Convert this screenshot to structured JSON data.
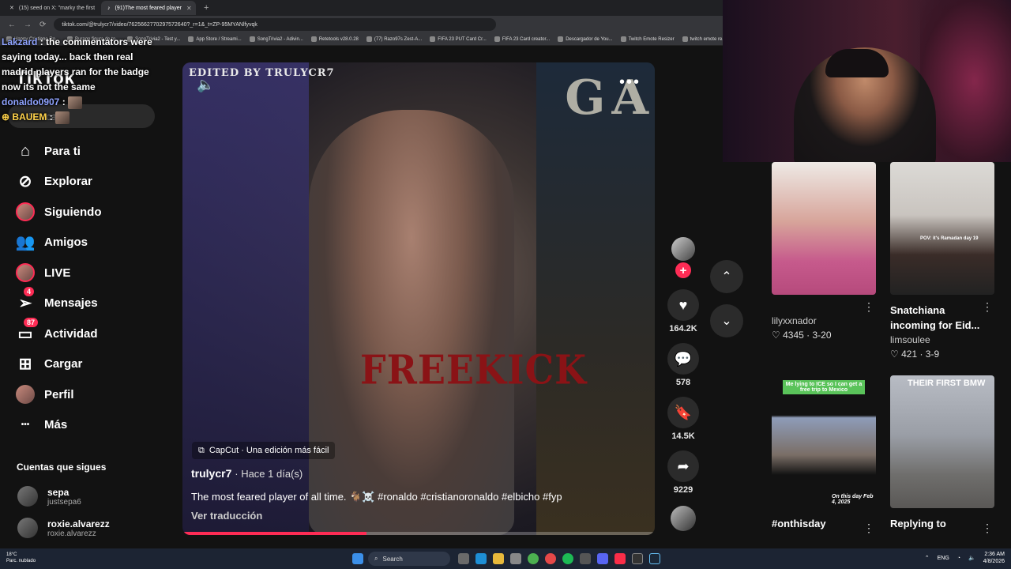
{
  "browser": {
    "tabs": [
      {
        "label": "(15) seed on X: \"marky the first",
        "active": false
      },
      {
        "label": "(91)The most feared player",
        "active": true
      }
    ],
    "url": "tiktok.com/@trulycr7/video/7625662770297572640?_r=1&_t=ZP-95MYANlfyvqk",
    "bookmarks": [
      "Happy Cristiano Ro...",
      "Burago figura de to...",
      "SongTrivia2 - Test y...",
      "App Store / Streami...",
      "SongTrivia2 - Adivin...",
      "Retetools v28.0.28",
      "(77) Razo97s Zest-A...",
      "FIFA 23 PUT Card Cr...",
      "FIFA 23 Card creator...",
      "Descargador de You...",
      "Twitch Emote Resizer",
      "twitch emote re..."
    ]
  },
  "sidebar": {
    "logo": "TikTok",
    "search_placeholder": "Buscar",
    "nav": [
      {
        "label": "Para ti",
        "icon": "home-icon"
      },
      {
        "label": "Explorar",
        "icon": "compass-icon"
      },
      {
        "label": "Siguiendo",
        "icon": "following-avatar-icon"
      },
      {
        "label": "Amigos",
        "icon": "friends-icon"
      },
      {
        "label": "LIVE",
        "icon": "live-avatar-icon"
      },
      {
        "label": "Mensajes",
        "icon": "messages-icon",
        "badge": "4"
      },
      {
        "label": "Actividad",
        "icon": "activity-icon",
        "badge": "87"
      },
      {
        "label": "Cargar",
        "icon": "upload-icon"
      },
      {
        "label": "Perfil",
        "icon": "profile-icon"
      },
      {
        "label": "Más",
        "icon": "more-icon"
      }
    ],
    "following_title": "Cuentas que sigues",
    "following": [
      {
        "name": "sepa",
        "handle": "justsepa6"
      },
      {
        "name": "roxie.alvarezz",
        "handle": "roxie.alvarezz"
      }
    ]
  },
  "chat": {
    "lines": [
      {
        "user": "Lakzard",
        "text": "the commentators were saying today... back then real madrid players ran for the badge now its not the same"
      },
      {
        "user": "donaldo0907",
        "text": ""
      },
      {
        "user": "BAUEM",
        "text": ""
      }
    ]
  },
  "video": {
    "watermark": "EDITED BY TRULYCR7",
    "overlay_text": "FREEKICK",
    "capcut": "CapCut · Una edición más fácil",
    "author": "trulycr7",
    "posted": "· Hace 1 día(s)",
    "caption": "The most feared player of all time. 🐐☠️ #ronaldo #cristianoronaldo #elbicho #fyp",
    "translate": "Ver traducción",
    "progress_percent": 39
  },
  "actions": {
    "likes": "164.2K",
    "comments": "578",
    "saves": "14.5K",
    "shares": "9229"
  },
  "feed": [
    {
      "title": "",
      "author": "lilyxxnador",
      "likes": "4345",
      "date": "3-20",
      "thumb_color": "#c9847e"
    },
    {
      "title": "Snatchiana incoming for Eid...",
      "author": "limsoulee",
      "likes": "421",
      "date": "3-9",
      "thumb_color": "#d8d6d2",
      "thumb_text": "POV: it's Ramadan day 19"
    },
    {
      "title": "#onthisday",
      "author": "",
      "likes": "",
      "date": "",
      "thumb_color": "#f2f2f2",
      "thumb_text": "Me lying to ICE so I can get a free trip to Mexico",
      "thumb_text2": "On this day Feb 4, 2025"
    },
    {
      "title": "Replying to",
      "author": "",
      "likes": "",
      "date": "",
      "thumb_color": "#8d8f93",
      "thumb_text": "THEIR FIRST BMW"
    }
  ],
  "taskbar": {
    "weather_temp": "18°C",
    "weather_desc": "Parc. nublado",
    "search": "Search",
    "lang": "ENG",
    "time": "2:36 AM",
    "date": "4/8/2026"
  },
  "colors": {
    "accent": "#fe2c55",
    "bg": "#121212"
  }
}
